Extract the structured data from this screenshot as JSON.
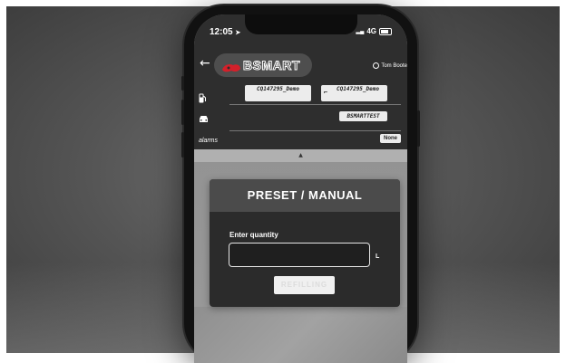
{
  "status_bar": {
    "time": "12:05",
    "network": "4G"
  },
  "header": {
    "back_icon": "arrow-left-icon",
    "brand": "BSMART",
    "user_name": "Tom Boote"
  },
  "info": {
    "pump_chip": "CQ147295_Demo",
    "nozzle_chip": "CQ147295_Demo",
    "vehicle_chip": "BSMARTTEST",
    "alarms_label": "alarms",
    "alarms_value": "None"
  },
  "card": {
    "title": "PRESET / MANUAL",
    "quantity_label": "Enter quantity",
    "quantity_value": "",
    "unit": "L",
    "button_label": "REFILLING"
  },
  "colors": {
    "brand_red": "#d4202a",
    "header_dark": "#2e2e2e",
    "card_dark": "#2b2b2b"
  }
}
